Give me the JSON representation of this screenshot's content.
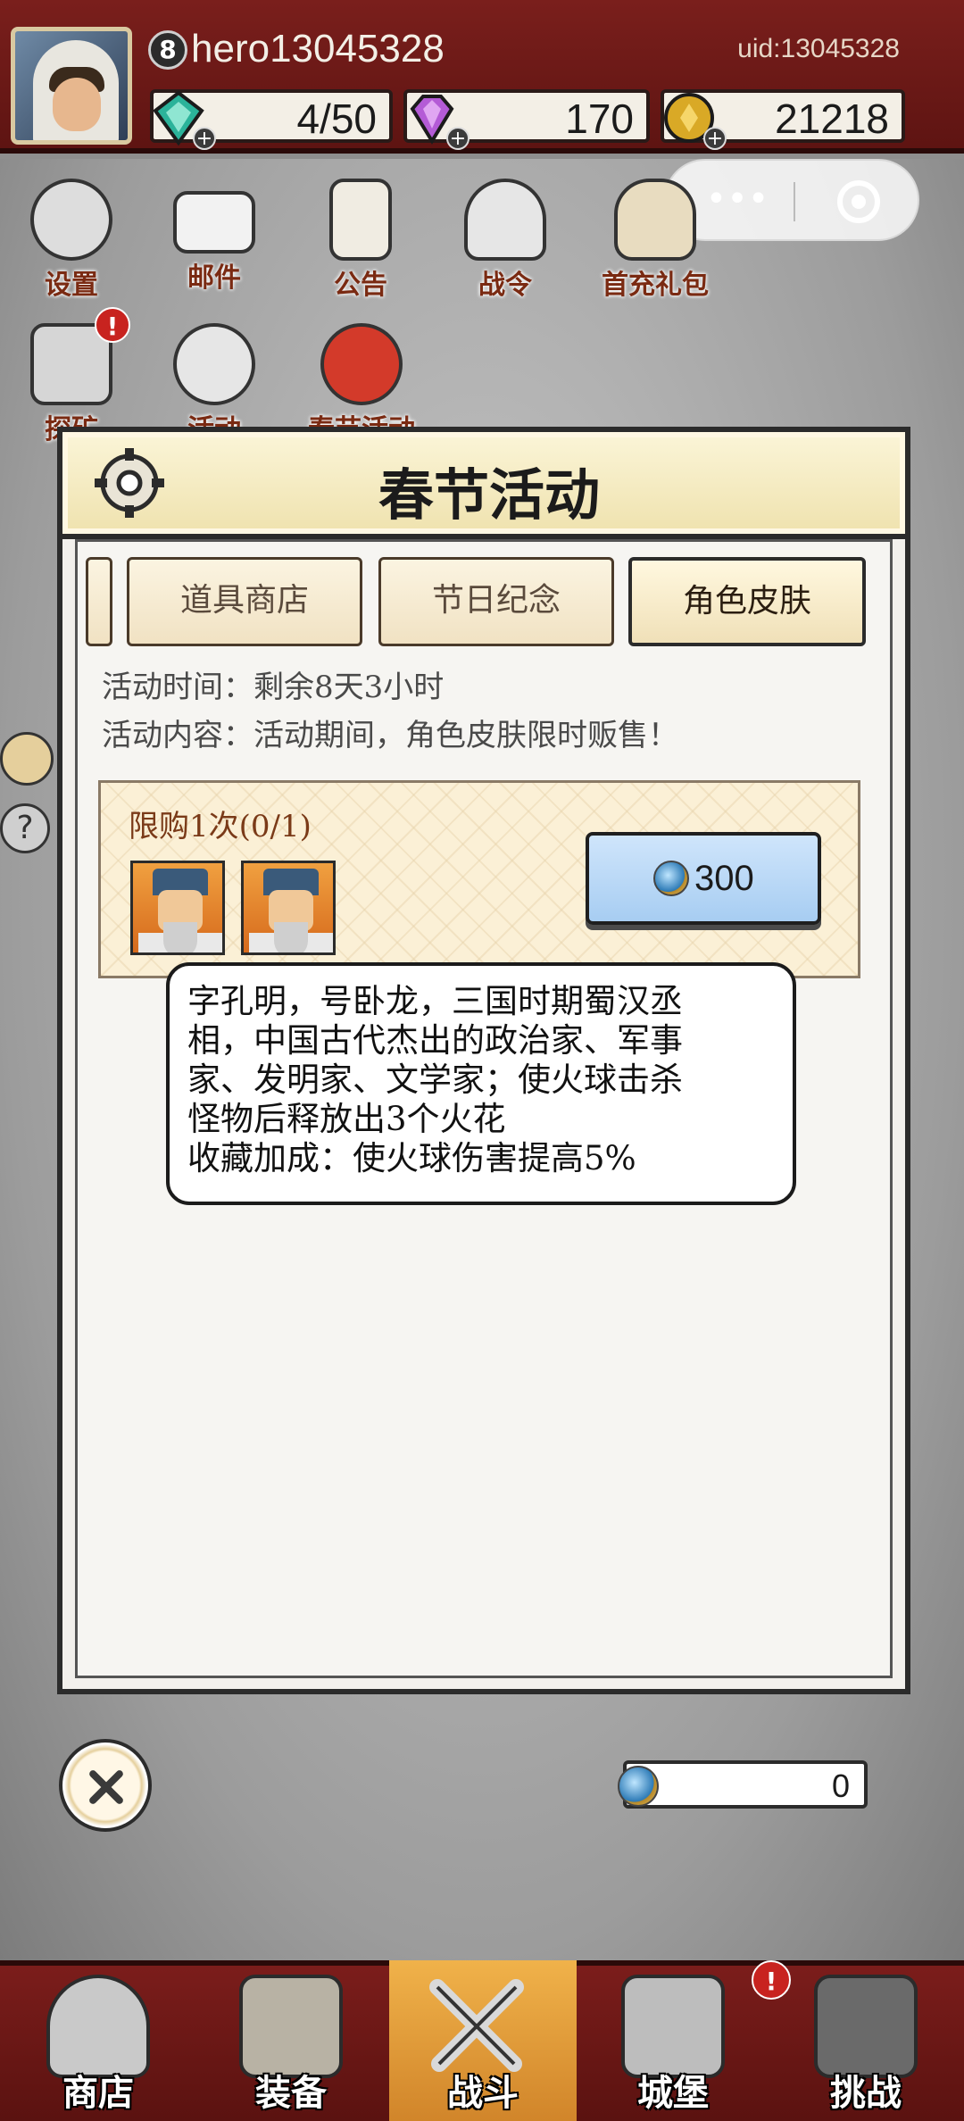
{
  "header": {
    "level": "8",
    "player_name": "hero13045328",
    "uid": "uid:13045328",
    "resources": [
      {
        "name": "energy",
        "icon": "green-crystal-icon",
        "value": "4/50"
      },
      {
        "name": "gems",
        "icon": "purple-gem-icon",
        "value": "170"
      },
      {
        "name": "gold",
        "icon": "gold-coin-icon",
        "value": "21218"
      }
    ]
  },
  "top_menu": [
    {
      "label": "设置",
      "icon": "gear-icon"
    },
    {
      "label": "邮件",
      "icon": "mail-icon"
    },
    {
      "label": "公告",
      "icon": "scroll-icon"
    },
    {
      "label": "战令",
      "icon": "battle-pass-icon"
    },
    {
      "label": "首充礼包",
      "icon": "gift-bag-icon"
    },
    {
      "label": "探矿",
      "icon": "mining-icon",
      "alert": "!"
    },
    {
      "label": "活动",
      "icon": "event-wreath-icon"
    },
    {
      "label": "春节活动",
      "icon": "lantern-icon"
    }
  ],
  "dialog": {
    "title": "春节活动",
    "tabs": [
      {
        "label": "道具商店",
        "active": false
      },
      {
        "label": "节日纪念",
        "active": false
      },
      {
        "label": "角色皮肤",
        "active": true
      }
    ],
    "activity_time": "活动时间：剩余8天3小时",
    "activity_content": "活动内容：活动期间，角色皮肤限时贩售！",
    "offer": {
      "limit": "限购1次(0/1)",
      "price": "300",
      "currency_icon": "blue-coin-icon"
    },
    "tooltip_lines": [
      "字孔明，号卧龙，三国时期蜀汉丞",
      "相，中国古代杰出的政治家、军事",
      "家、发明家、文学家；使火球击杀",
      "怪物后释放出3个火花",
      "收藏加成：使火球伤害提高5%"
    ],
    "balance": "0"
  },
  "bottom_nav": [
    {
      "label": "商店",
      "icon": "shop-hut-icon",
      "active": false
    },
    {
      "label": "装备",
      "icon": "backpack-icon",
      "active": false
    },
    {
      "label": "战斗",
      "icon": "crossed-swords-icon",
      "active": true
    },
    {
      "label": "城堡",
      "icon": "castle-tower-icon",
      "active": false,
      "alert": "!"
    },
    {
      "label": "挑战",
      "icon": "locked-fortress-icon",
      "active": false
    }
  ],
  "colors": {
    "header_red": "#7a1f1c",
    "tab_label": "#5a4a3c",
    "limit_text": "#7a3a18",
    "buy_button_blue": "#a7cdf2"
  }
}
